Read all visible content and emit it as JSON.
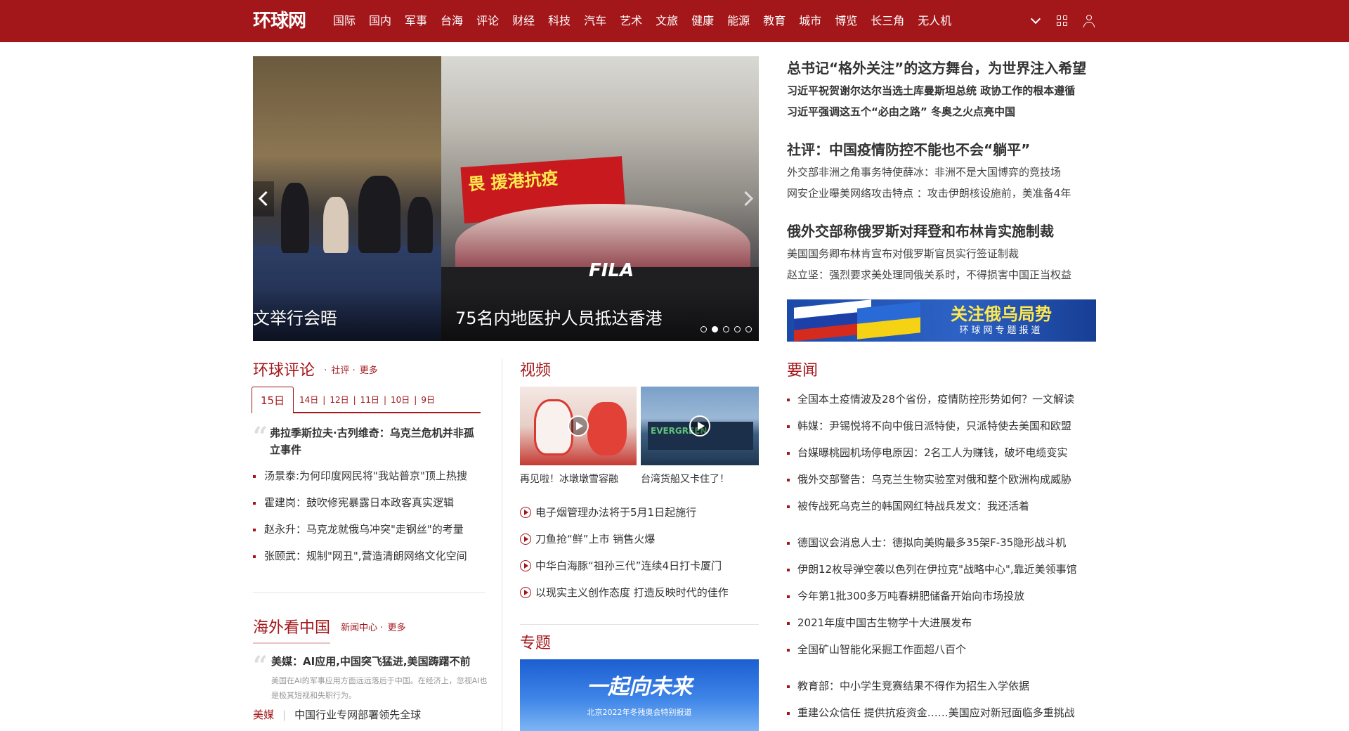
{
  "header": {
    "logo_text": "环球网",
    "nav": [
      "国际",
      "国内",
      "军事",
      "台海",
      "评论",
      "财经",
      "科技",
      "汽车",
      "艺术",
      "文旅",
      "健康",
      "能源",
      "教育",
      "城市",
      "博览",
      "长三角",
      "无人机"
    ]
  },
  "slider": {
    "captions": [
      "文举行会晤",
      "75名内地医护人员抵达香港"
    ],
    "banner_text": "畏 援港抗疫",
    "bag_brand": "FILA"
  },
  "headlines": {
    "groups": [
      {
        "title": "总书记“格外关注”的这方舞台，为世界注入希望",
        "subs": [
          "习近平祝贺谢尔达尔当选土库曼斯坦总统 政协工作的根本遵循",
          "习近平强调这五个“必由之路” 冬奥之火点亮中国"
        ],
        "bold_subs": true
      },
      {
        "title": "社评：中国疫情防控不能也不会“躺平”",
        "subs": [
          "外交部非洲之角事务特使薛冰：非洲不是大国博弈的竞技场",
          "网安企业曝美网络攻击特点 ：攻击伊朗核设施前，美准备4年"
        ],
        "bold_subs": false
      },
      {
        "title": "俄外交部称俄罗斯对拜登和布林肯实施制裁",
        "subs": [
          "美国国务卿布林肯宣布对俄罗斯官员实行签证制裁",
          "赵立坚：强烈要求美处理同俄关系时，不得损害中国正当权益"
        ],
        "bold_subs": false
      }
    ],
    "special_banner": {
      "title": "关注俄乌局势",
      "subtitle": "环球网专题报道"
    }
  },
  "commentary": {
    "title": "环球评论",
    "links": [
      "社评",
      "更多"
    ],
    "active_date": "15日",
    "dates": [
      "14日",
      "12日",
      "11日",
      "10日",
      "9日"
    ],
    "feature": "弗拉季斯拉夫·古列维奇：乌克兰危机并非孤立事件",
    "items": [
      "汤景泰:为何印度网民将\"我站普京\"顶上热搜",
      "霍建岗：鼓吹修宪暴露日本政客真实逻辑",
      "赵永升：马克龙就俄乌冲突\"走钢丝\"的考量",
      "张颐武：规制\"网丑\",营造清朗网络文化空间"
    ]
  },
  "overseas": {
    "title": "海外看中国",
    "links": [
      "新闻中心",
      "更多"
    ],
    "feature": "美媒：AI应用,中国突飞猛进,美国踌躇不前",
    "desc": "美国在AI的军事应用方面远远落后于中国。在经济上，忽视AI也是极其短视和失职行为。",
    "item_tag": "美媒",
    "item_text": "中国行业专网部署领先全球"
  },
  "video": {
    "title": "视频",
    "thumbs": [
      {
        "caption": "再见啦！冰墩墩雪容融"
      },
      {
        "caption": "台湾货船又卡住了！",
        "ship_text": "EVERGREEN"
      }
    ],
    "items": [
      "电子烟管理办法将于5月1日起施行",
      "刀鱼抢“鲜”上市 销售火爆",
      "中华白海豚“祖孙三代”连续4日打卡厦门",
      "以现实主义创作态度 打造反映时代的佳作"
    ]
  },
  "topic": {
    "title": "专题",
    "banner_title": "一起向未来",
    "banner_sub": "北京2022年冬残奥会特别报道"
  },
  "news": {
    "title": "要闻",
    "group1": [
      "全国本土疫情波及28个省份，疫情防控形势如何？一文解读",
      "韩媒：尹锡悦将不向中俄日派特使，只派特使去美国和欧盟",
      "台媒曝桃园机场停电原因：2名工人为赚钱，破坏电缆变实",
      "俄外交部警告：乌克兰生物实验室对俄和整个欧洲构成威胁",
      "被传战死乌克兰的韩国网红特战兵发文：我还活着"
    ],
    "group2": [
      "德国议会消息人士：德拟向美购最多35架F-35隐形战斗机",
      "伊朗12枚导弹空袭以色列在伊拉克\"战略中心\",靠近美领事馆",
      "今年第1批300多万吨春耕肥储备开始向市场投放",
      "2021年度中国古生物学十大进展发布",
      "全国矿山智能化采掘工作面超八百个"
    ],
    "group3": [
      "教育部：中小学生竞赛结果不得作为招生入学依据",
      "重建公众信任 提供抗疫资金……美国应对新冠面临多重挑战"
    ]
  },
  "colors": {
    "brand": "#a3161a"
  }
}
